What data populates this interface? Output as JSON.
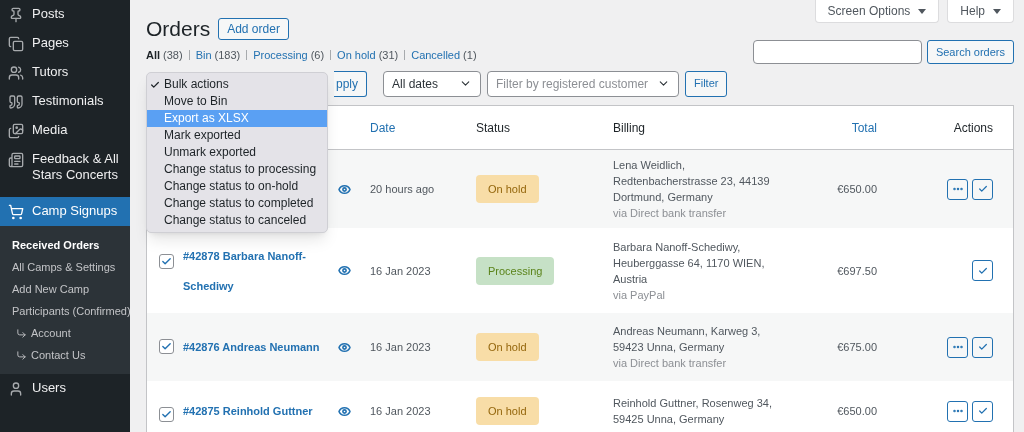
{
  "sidebar": {
    "items": [
      {
        "label": "Posts",
        "kind": "pin",
        "selected": false
      },
      {
        "label": "Pages",
        "kind": "pages",
        "selected": false
      },
      {
        "label": "Tutors",
        "kind": "people",
        "selected": false
      },
      {
        "label": "Testimonials",
        "kind": "quote",
        "selected": false
      },
      {
        "label": "Media",
        "kind": "media",
        "selected": false
      },
      {
        "label": "Feedback & All Stars Concerts",
        "kind": "form",
        "selected": false
      },
      {
        "label": "Camp Signups",
        "kind": "cart",
        "selected": true,
        "children": [
          {
            "label": "Received Orders",
            "selected": true
          },
          {
            "label": "All Camps & Settings",
            "selected": false
          },
          {
            "label": "Add New Camp",
            "selected": false
          },
          {
            "label": "Participants (Confirmed)",
            "selected": false,
            "children": [
              {
                "label": "Account",
                "selected": false
              },
              {
                "label": "Contact Us",
                "selected": false
              }
            ]
          }
        ]
      },
      {
        "label": "Users",
        "kind": "user",
        "selected": false
      }
    ]
  },
  "header": {
    "title": "Orders",
    "add_button": "Add order",
    "screen_options": "Screen Options",
    "help": "Help"
  },
  "filters": [
    {
      "label": "All",
      "count": "(38)",
      "selected": true
    },
    {
      "label": "Bin",
      "count": "(183)",
      "selected": false
    },
    {
      "label": "Processing",
      "count": "(6)",
      "selected": false
    },
    {
      "label": "On hold",
      "count": "(31)",
      "selected": false
    },
    {
      "label": "Cancelled",
      "count": "(1)",
      "selected": false
    }
  ],
  "search": {
    "button": "Search orders"
  },
  "toolbar": {
    "apply": "pply",
    "dates": "All dates",
    "customer_placeholder": "Filter by registered customer",
    "filter": "Filter"
  },
  "bulk_menu": [
    {
      "label": "Bulk actions",
      "checked": true,
      "selected": false
    },
    {
      "label": "Move to Bin",
      "checked": false,
      "selected": false
    },
    {
      "label": "Export as XLSX",
      "checked": false,
      "selected": true
    },
    {
      "label": "Mark exported",
      "checked": false,
      "selected": false
    },
    {
      "label": "Unmark exported",
      "checked": false,
      "selected": false
    },
    {
      "label": "Change status to processing",
      "checked": false,
      "selected": false
    },
    {
      "label": "Change status to on-hold",
      "checked": false,
      "selected": false
    },
    {
      "label": "Change status to completed",
      "checked": false,
      "selected": false
    },
    {
      "label": "Change status to canceled",
      "checked": false,
      "selected": false
    }
  ],
  "table": {
    "columns": [
      {
        "label": "Date",
        "sortable": true
      },
      {
        "label": "Status",
        "sortable": false
      },
      {
        "label": "Billing",
        "sortable": false
      },
      {
        "label": "Total",
        "sortable": true
      },
      {
        "label": "Actions",
        "sortable": false
      }
    ],
    "rows": [
      {
        "date": "20 hours ago",
        "status": {
          "label": "On hold",
          "kind": "on-hold"
        },
        "billing": "Lena Weidlich, Redtenbacherstrasse 23, 44139 Dortmund, Germany",
        "payment": "via Direct bank transfer",
        "total": "€650.00",
        "actions": [
          {
            "kind": "more"
          },
          {
            "kind": "complete"
          }
        ]
      },
      {
        "checked": true,
        "order": "#42878 Barbara Nanoff-Schediwy",
        "date": "16 Jan 2023",
        "status": {
          "label": "Processing",
          "kind": "processing"
        },
        "billing": "Barbara Nanoff-Schediwy, Heuberggasse 64, 1170 WIEN, Austria",
        "payment": "via PayPal",
        "total": "€697.50",
        "actions": [
          {
            "kind": "complete"
          }
        ]
      },
      {
        "checked": true,
        "order": "#42876 Andreas Neumann",
        "date": "16 Jan 2023",
        "status": {
          "label": "On hold",
          "kind": "on-hold"
        },
        "billing": "Andreas Neumann, Karweg 3, 59423 Unna, Germany",
        "payment": "via Direct bank transfer",
        "total": "€675.00",
        "actions": [
          {
            "kind": "more"
          },
          {
            "kind": "complete"
          }
        ]
      },
      {
        "checked": true,
        "order": "#42875 Reinhold Guttner",
        "date": "16 Jan 2023",
        "status": {
          "label": "On hold",
          "kind": "on-hold"
        },
        "billing": "Reinhold Guttner, Rosenweg 34, 59425 Unna, Germany",
        "total": "€650.00",
        "actions": [
          {
            "kind": "more"
          },
          {
            "kind": "complete"
          }
        ]
      }
    ]
  }
}
